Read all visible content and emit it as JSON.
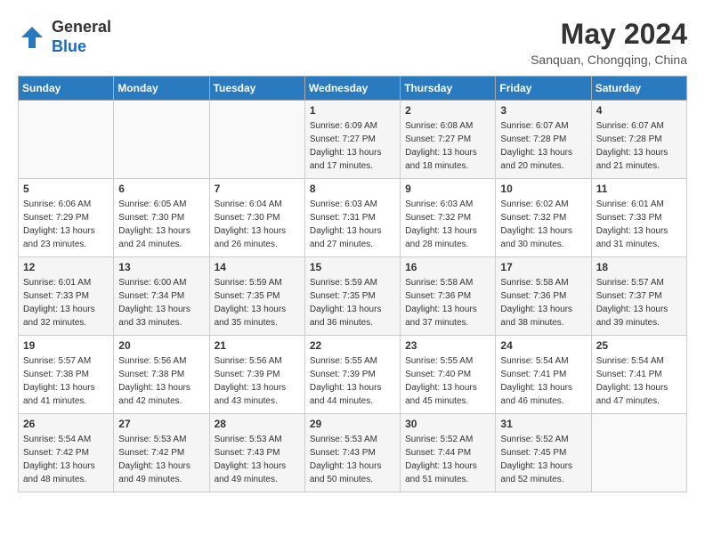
{
  "header": {
    "logo_general": "General",
    "logo_blue": "Blue",
    "month_year": "May 2024",
    "location": "Sanquan, Chongqing, China"
  },
  "days_of_week": [
    "Sunday",
    "Monday",
    "Tuesday",
    "Wednesday",
    "Thursday",
    "Friday",
    "Saturday"
  ],
  "weeks": [
    [
      {
        "day": "",
        "sunrise": "",
        "sunset": "",
        "daylight": ""
      },
      {
        "day": "",
        "sunrise": "",
        "sunset": "",
        "daylight": ""
      },
      {
        "day": "",
        "sunrise": "",
        "sunset": "",
        "daylight": ""
      },
      {
        "day": "1",
        "sunrise": "Sunrise: 6:09 AM",
        "sunset": "Sunset: 7:27 PM",
        "daylight": "Daylight: 13 hours and 17 minutes."
      },
      {
        "day": "2",
        "sunrise": "Sunrise: 6:08 AM",
        "sunset": "Sunset: 7:27 PM",
        "daylight": "Daylight: 13 hours and 18 minutes."
      },
      {
        "day": "3",
        "sunrise": "Sunrise: 6:07 AM",
        "sunset": "Sunset: 7:28 PM",
        "daylight": "Daylight: 13 hours and 20 minutes."
      },
      {
        "day": "4",
        "sunrise": "Sunrise: 6:07 AM",
        "sunset": "Sunset: 7:28 PM",
        "daylight": "Daylight: 13 hours and 21 minutes."
      }
    ],
    [
      {
        "day": "5",
        "sunrise": "Sunrise: 6:06 AM",
        "sunset": "Sunset: 7:29 PM",
        "daylight": "Daylight: 13 hours and 23 minutes."
      },
      {
        "day": "6",
        "sunrise": "Sunrise: 6:05 AM",
        "sunset": "Sunset: 7:30 PM",
        "daylight": "Daylight: 13 hours and 24 minutes."
      },
      {
        "day": "7",
        "sunrise": "Sunrise: 6:04 AM",
        "sunset": "Sunset: 7:30 PM",
        "daylight": "Daylight: 13 hours and 26 minutes."
      },
      {
        "day": "8",
        "sunrise": "Sunrise: 6:03 AM",
        "sunset": "Sunset: 7:31 PM",
        "daylight": "Daylight: 13 hours and 27 minutes."
      },
      {
        "day": "9",
        "sunrise": "Sunrise: 6:03 AM",
        "sunset": "Sunset: 7:32 PM",
        "daylight": "Daylight: 13 hours and 28 minutes."
      },
      {
        "day": "10",
        "sunrise": "Sunrise: 6:02 AM",
        "sunset": "Sunset: 7:32 PM",
        "daylight": "Daylight: 13 hours and 30 minutes."
      },
      {
        "day": "11",
        "sunrise": "Sunrise: 6:01 AM",
        "sunset": "Sunset: 7:33 PM",
        "daylight": "Daylight: 13 hours and 31 minutes."
      }
    ],
    [
      {
        "day": "12",
        "sunrise": "Sunrise: 6:01 AM",
        "sunset": "Sunset: 7:33 PM",
        "daylight": "Daylight: 13 hours and 32 minutes."
      },
      {
        "day": "13",
        "sunrise": "Sunrise: 6:00 AM",
        "sunset": "Sunset: 7:34 PM",
        "daylight": "Daylight: 13 hours and 33 minutes."
      },
      {
        "day": "14",
        "sunrise": "Sunrise: 5:59 AM",
        "sunset": "Sunset: 7:35 PM",
        "daylight": "Daylight: 13 hours and 35 minutes."
      },
      {
        "day": "15",
        "sunrise": "Sunrise: 5:59 AM",
        "sunset": "Sunset: 7:35 PM",
        "daylight": "Daylight: 13 hours and 36 minutes."
      },
      {
        "day": "16",
        "sunrise": "Sunrise: 5:58 AM",
        "sunset": "Sunset: 7:36 PM",
        "daylight": "Daylight: 13 hours and 37 minutes."
      },
      {
        "day": "17",
        "sunrise": "Sunrise: 5:58 AM",
        "sunset": "Sunset: 7:36 PM",
        "daylight": "Daylight: 13 hours and 38 minutes."
      },
      {
        "day": "18",
        "sunrise": "Sunrise: 5:57 AM",
        "sunset": "Sunset: 7:37 PM",
        "daylight": "Daylight: 13 hours and 39 minutes."
      }
    ],
    [
      {
        "day": "19",
        "sunrise": "Sunrise: 5:57 AM",
        "sunset": "Sunset: 7:38 PM",
        "daylight": "Daylight: 13 hours and 41 minutes."
      },
      {
        "day": "20",
        "sunrise": "Sunrise: 5:56 AM",
        "sunset": "Sunset: 7:38 PM",
        "daylight": "Daylight: 13 hours and 42 minutes."
      },
      {
        "day": "21",
        "sunrise": "Sunrise: 5:56 AM",
        "sunset": "Sunset: 7:39 PM",
        "daylight": "Daylight: 13 hours and 43 minutes."
      },
      {
        "day": "22",
        "sunrise": "Sunrise: 5:55 AM",
        "sunset": "Sunset: 7:39 PM",
        "daylight": "Daylight: 13 hours and 44 minutes."
      },
      {
        "day": "23",
        "sunrise": "Sunrise: 5:55 AM",
        "sunset": "Sunset: 7:40 PM",
        "daylight": "Daylight: 13 hours and 45 minutes."
      },
      {
        "day": "24",
        "sunrise": "Sunrise: 5:54 AM",
        "sunset": "Sunset: 7:41 PM",
        "daylight": "Daylight: 13 hours and 46 minutes."
      },
      {
        "day": "25",
        "sunrise": "Sunrise: 5:54 AM",
        "sunset": "Sunset: 7:41 PM",
        "daylight": "Daylight: 13 hours and 47 minutes."
      }
    ],
    [
      {
        "day": "26",
        "sunrise": "Sunrise: 5:54 AM",
        "sunset": "Sunset: 7:42 PM",
        "daylight": "Daylight: 13 hours and 48 minutes."
      },
      {
        "day": "27",
        "sunrise": "Sunrise: 5:53 AM",
        "sunset": "Sunset: 7:42 PM",
        "daylight": "Daylight: 13 hours and 49 minutes."
      },
      {
        "day": "28",
        "sunrise": "Sunrise: 5:53 AM",
        "sunset": "Sunset: 7:43 PM",
        "daylight": "Daylight: 13 hours and 49 minutes."
      },
      {
        "day": "29",
        "sunrise": "Sunrise: 5:53 AM",
        "sunset": "Sunset: 7:43 PM",
        "daylight": "Daylight: 13 hours and 50 minutes."
      },
      {
        "day": "30",
        "sunrise": "Sunrise: 5:52 AM",
        "sunset": "Sunset: 7:44 PM",
        "daylight": "Daylight: 13 hours and 51 minutes."
      },
      {
        "day": "31",
        "sunrise": "Sunrise: 5:52 AM",
        "sunset": "Sunset: 7:45 PM",
        "daylight": "Daylight: 13 hours and 52 minutes."
      },
      {
        "day": "",
        "sunrise": "",
        "sunset": "",
        "daylight": ""
      }
    ]
  ]
}
